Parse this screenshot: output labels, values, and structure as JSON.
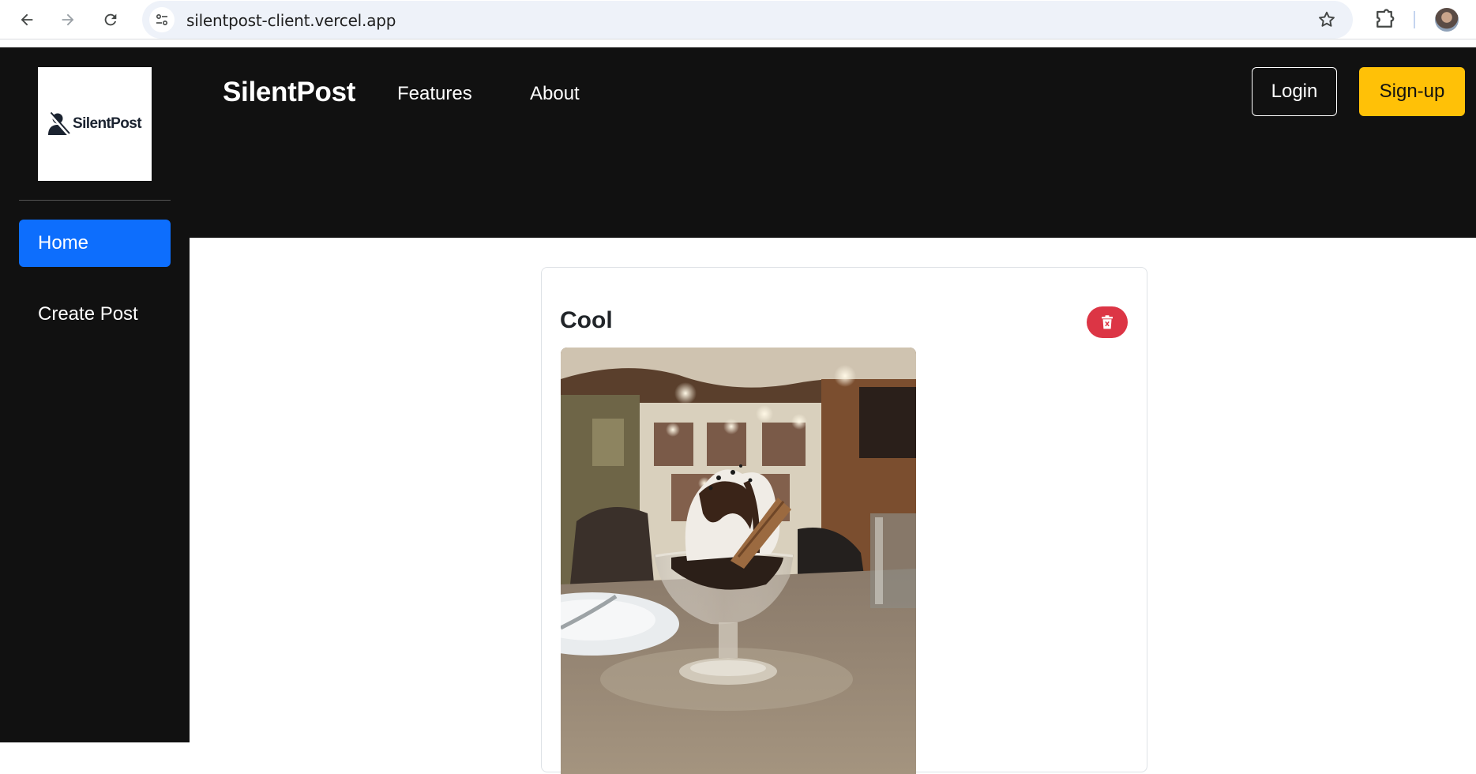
{
  "browser": {
    "url": "silentpost-client.vercel.app",
    "icons": [
      "back-arrow-icon",
      "forward-arrow-icon",
      "reload-icon",
      "site-info-icon",
      "bookmark-star-icon",
      "extensions-puzzle-icon",
      "profile-avatar"
    ]
  },
  "sidebar": {
    "logo_text": "SilentPost",
    "items": [
      {
        "label": "Home",
        "active": true
      },
      {
        "label": "Create Post",
        "active": false
      }
    ]
  },
  "header": {
    "brand": "SilentPost",
    "links": [
      "Features",
      "About"
    ],
    "login_label": "Login",
    "signup_label": "Sign-up"
  },
  "post": {
    "title": "Cool",
    "delete_icon": "trash-icon",
    "image_alt": "ice cream sundae in a glass bowl"
  },
  "colors": {
    "dark": "#111111",
    "primary": "#0d6efd",
    "warning": "#ffc107",
    "danger": "#dc3545"
  }
}
